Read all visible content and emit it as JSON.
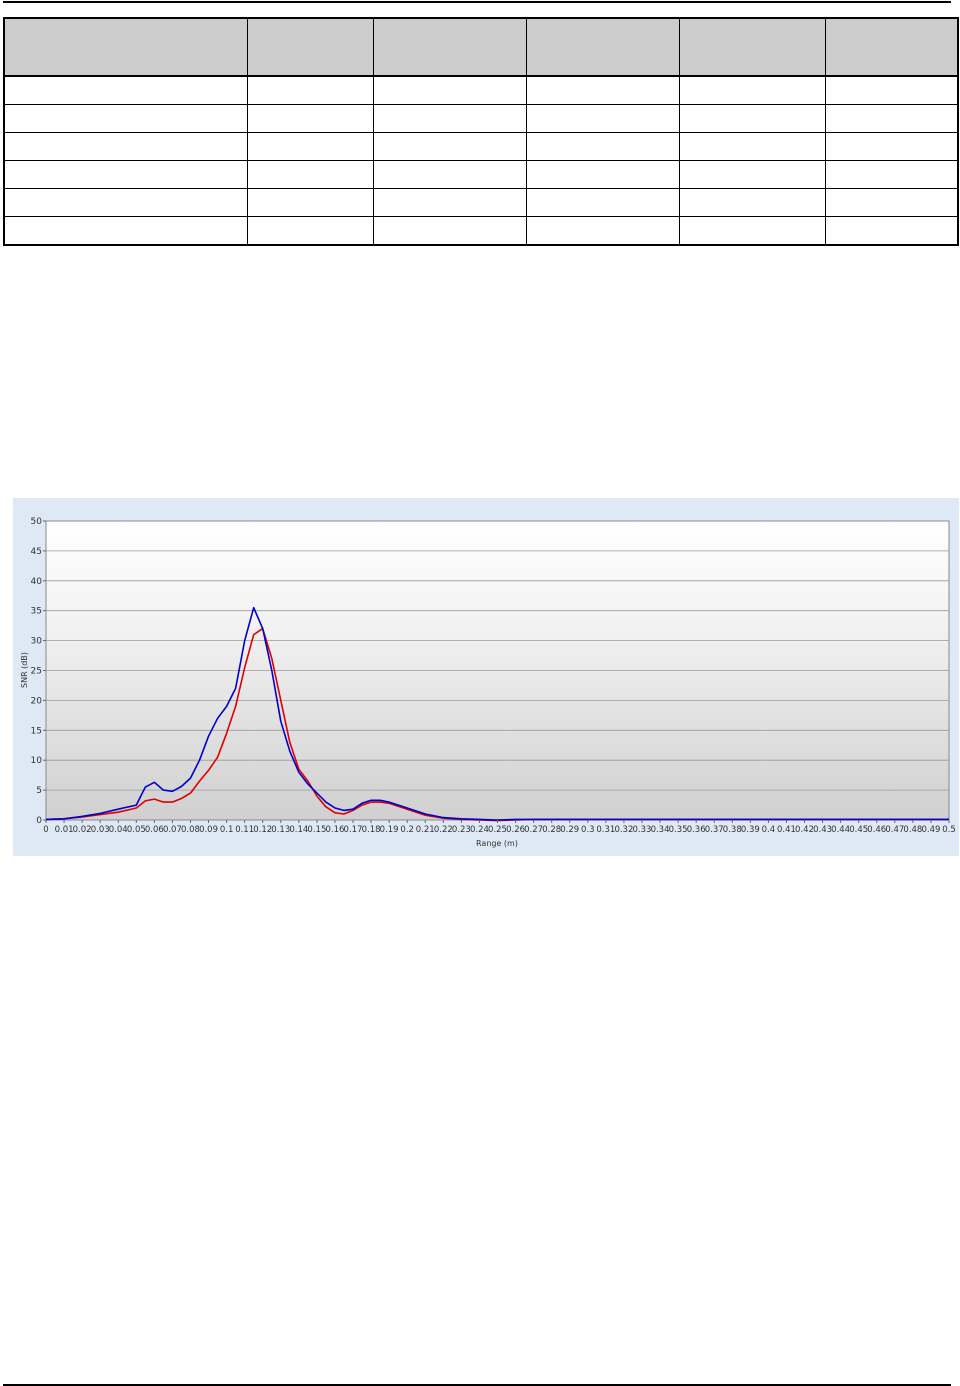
{
  "table": {
    "columns": [
      "",
      "",
      "",
      "",
      "",
      ""
    ],
    "rows": [
      [
        "",
        "",
        "",
        "",
        "",
        ""
      ],
      [
        "",
        "",
        "",
        "",
        "",
        ""
      ],
      [
        "",
        "",
        "",
        "",
        "",
        ""
      ],
      [
        "",
        "",
        "",
        "",
        "",
        ""
      ],
      [
        "",
        "",
        "",
        "",
        "",
        ""
      ],
      [
        "",
        "",
        "",
        "",
        "",
        ""
      ]
    ]
  },
  "chart_data": {
    "type": "line",
    "xlabel": "Range (m)",
    "ylabel": "SNR (dB)",
    "xlim": [
      0,
      0.5
    ],
    "ylim": [
      0,
      50
    ],
    "x_ticks": [
      "0",
      "0.01",
      "0.02",
      "0.03",
      "0.04",
      "0.05",
      "0.06",
      "0.07",
      "0.08",
      "0.09",
      "0.1",
      "0.11",
      "0.12",
      "0.13",
      "0.14",
      "0.15",
      "0.16",
      "0.17",
      "0.18",
      "0.19",
      "0.2",
      "0.21",
      "0.22",
      "0.23",
      "0.24",
      "0.25",
      "0.26",
      "0.27",
      "0.28",
      "0.29",
      "0.3",
      "0.31",
      "0.32",
      "0.33",
      "0.34",
      "0.35",
      "0.36",
      "0.37",
      "0.38",
      "0.39",
      "0.4",
      "0.41",
      "0.42",
      "0.43",
      "0.44",
      "0.45",
      "0.46",
      "0.47",
      "0.48",
      "0.49",
      "0.5"
    ],
    "y_ticks": [
      "0",
      "5",
      "10",
      "15",
      "20",
      "25",
      "30",
      "35",
      "40",
      "45",
      "50"
    ],
    "grid": true,
    "series": [
      {
        "color": "#e00000",
        "x": [
          0,
          0.01,
          0.02,
          0.03,
          0.04,
          0.05,
          0.055,
          0.06,
          0.065,
          0.07,
          0.075,
          0.08,
          0.085,
          0.09,
          0.095,
          0.1,
          0.105,
          0.11,
          0.115,
          0.12,
          0.125,
          0.13,
          0.135,
          0.14,
          0.145,
          0.15,
          0.155,
          0.16,
          0.165,
          0.17,
          0.175,
          0.18,
          0.185,
          0.19,
          0.2,
          0.21,
          0.22,
          0.23,
          0.24,
          0.25,
          0.26,
          0.27,
          0.3,
          0.35,
          0.4,
          0.45,
          0.5
        ],
        "y": [
          0.1,
          0.2,
          0.5,
          0.9,
          1.3,
          2.0,
          3.2,
          3.5,
          3.0,
          3.0,
          3.6,
          4.5,
          6.5,
          8.3,
          10.5,
          14.5,
          19.0,
          25.5,
          31.0,
          32.0,
          27.0,
          20.0,
          13.0,
          8.5,
          6.5,
          4.0,
          2.2,
          1.2,
          1.0,
          1.6,
          2.5,
          3.0,
          3.0,
          2.8,
          1.8,
          0.8,
          0.3,
          0.1,
          0.0,
          -0.1,
          0.0,
          0.1,
          0.1,
          0.1,
          0.1,
          0.1,
          0.1
        ]
      },
      {
        "color": "#0000d0",
        "x": [
          0,
          0.01,
          0.02,
          0.03,
          0.04,
          0.05,
          0.055,
          0.06,
          0.065,
          0.07,
          0.075,
          0.08,
          0.085,
          0.09,
          0.095,
          0.1,
          0.105,
          0.11,
          0.115,
          0.12,
          0.125,
          0.13,
          0.135,
          0.14,
          0.145,
          0.15,
          0.155,
          0.16,
          0.165,
          0.17,
          0.175,
          0.18,
          0.185,
          0.19,
          0.2,
          0.21,
          0.22,
          0.23,
          0.24,
          0.25,
          0.26,
          0.27,
          0.3,
          0.35,
          0.4,
          0.45,
          0.5
        ],
        "y": [
          0.1,
          0.2,
          0.6,
          1.1,
          1.8,
          2.5,
          5.5,
          6.3,
          5.0,
          4.8,
          5.6,
          7.0,
          10.0,
          14.0,
          17.0,
          19.0,
          22.0,
          30.0,
          35.5,
          32.0,
          25.0,
          16.5,
          11.5,
          8.0,
          6.0,
          4.5,
          3.0,
          2.0,
          1.6,
          1.8,
          2.8,
          3.3,
          3.3,
          3.0,
          2.0,
          1.0,
          0.4,
          0.2,
          0.1,
          0.0,
          0.1,
          0.1,
          0.1,
          0.1,
          0.1,
          0.1,
          0.1
        ]
      }
    ]
  }
}
